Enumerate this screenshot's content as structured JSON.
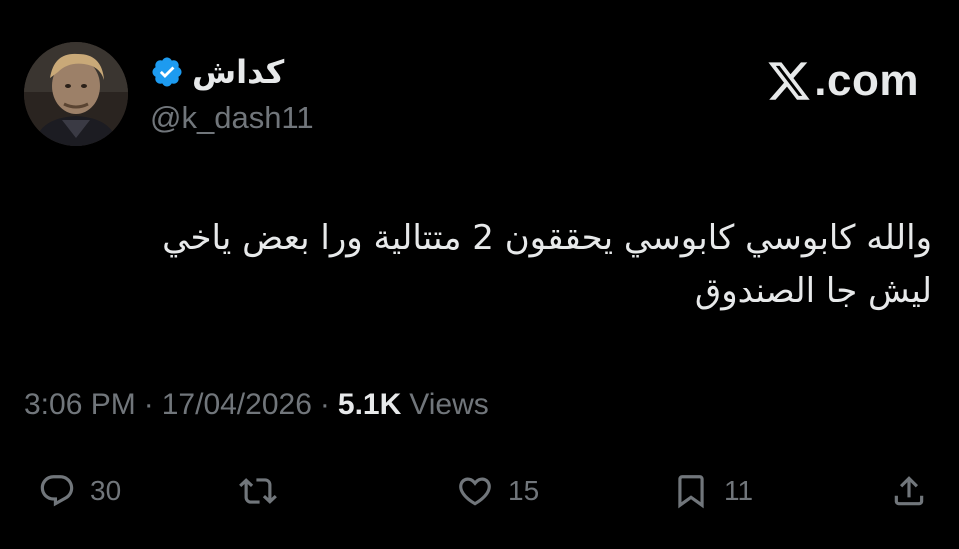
{
  "author": {
    "display_name": "كداش",
    "handle": "@k_dash11",
    "verified": true
  },
  "brand": {
    "text": ".com",
    "icon": "x-logo-icon"
  },
  "tweet": {
    "lines": [
      "والله كابوسي كابوسي يحققون 2 متتالية ورا بعض ياخي",
      "ليش جا الصندوق"
    ]
  },
  "meta": {
    "time": "3:06 PM",
    "separator": "·",
    "date": "17/04/2026",
    "views_count": "5.1K",
    "views_label": "Views"
  },
  "actions": {
    "reply": {
      "icon": "reply-icon",
      "count": "30"
    },
    "repost": {
      "icon": "repost-icon",
      "count": ""
    },
    "like": {
      "icon": "heart-icon",
      "count": "15"
    },
    "bookmark": {
      "icon": "bookmark-icon",
      "count": "11"
    },
    "share": {
      "icon": "share-icon",
      "count": ""
    }
  },
  "colors": {
    "background": "#000000",
    "primary_text": "#e7e9ea",
    "secondary_text": "#71767b",
    "verified_blue": "#1d9bf0"
  }
}
